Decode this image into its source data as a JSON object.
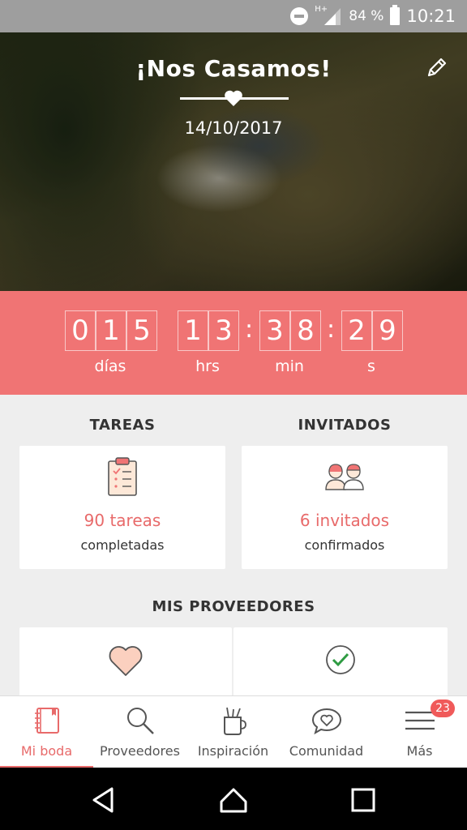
{
  "status_bar": {
    "network": "H+",
    "battery": "84 %",
    "time": "10:21"
  },
  "hero": {
    "title": "¡Nos Casamos!",
    "date": "14/10/2017",
    "edit_icon": "pencil-icon"
  },
  "countdown": {
    "days": [
      "0",
      "1",
      "5"
    ],
    "hours": [
      "1",
      "3"
    ],
    "minutes": [
      "3",
      "8"
    ],
    "seconds": [
      "2",
      "9"
    ],
    "separator": ":",
    "labels": {
      "days": "días",
      "hours": "hrs",
      "minutes": "min",
      "seconds": "s"
    }
  },
  "tareas": {
    "title": "TAREAS",
    "count": "90 tareas",
    "sub": "completadas",
    "icon": "clipboard-checklist-icon"
  },
  "invitados": {
    "title": "INVITADOS",
    "count": "6 invitados",
    "sub": "confirmados",
    "icon": "guests-couple-icon"
  },
  "proveedores": {
    "title": "MIS PROVEEDORES",
    "left_icon": "heart-icon",
    "right_icon": "check-circle-icon"
  },
  "nav": {
    "items": [
      {
        "label": "Mi boda",
        "icon": "notebook-icon"
      },
      {
        "label": "Proveedores",
        "icon": "search-icon"
      },
      {
        "label": "Inspiración",
        "icon": "cup-brushes-icon"
      },
      {
        "label": "Comunidad",
        "icon": "chat-heart-icon"
      },
      {
        "label": "Más",
        "icon": "menu-icon"
      }
    ],
    "badge": "23"
  },
  "colors": {
    "accent": "#f07474",
    "accent_text": "#e86a6a"
  }
}
